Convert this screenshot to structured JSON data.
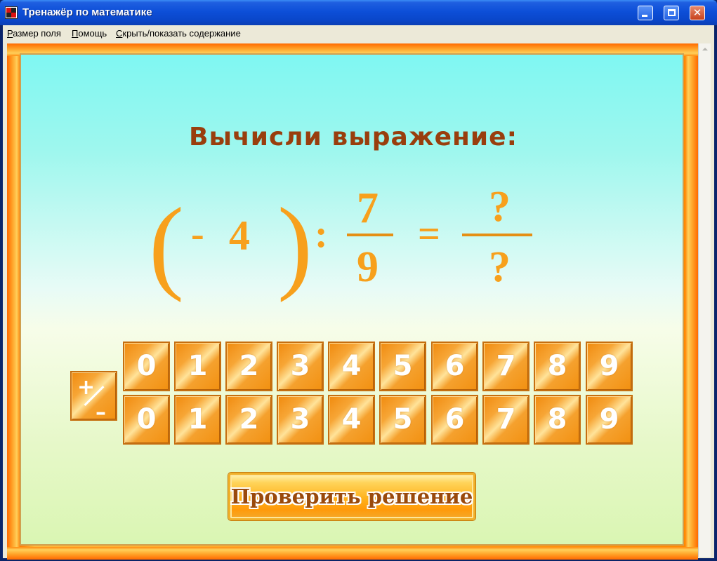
{
  "window": {
    "title": "Тренажёр по математике",
    "close_glyph": "✕"
  },
  "menu": {
    "items": [
      "Размер поля",
      "Помощь",
      "Скрыть/показать содержание"
    ]
  },
  "task": {
    "heading": "Вычисли выражение:",
    "open_paren": "(",
    "sign": "-",
    "number": "4",
    "close_paren": ")",
    "operator": ":",
    "fraction_numerator": "7",
    "fraction_denominator": "9",
    "equals": "=",
    "answer_numerator": "?",
    "answer_denominator": "?"
  },
  "keypad": {
    "sign_toggle": {
      "plus": "+",
      "minus": "–"
    },
    "numerator_digits": [
      "0",
      "1",
      "2",
      "3",
      "4",
      "5",
      "6",
      "7",
      "8",
      "9"
    ],
    "denominator_digits": [
      "0",
      "1",
      "2",
      "3",
      "4",
      "5",
      "6",
      "7",
      "8",
      "9"
    ]
  },
  "check_button": {
    "label": "Проверить решение"
  },
  "colors": {
    "title_bar": "#0a46c9",
    "heading": "#993e0d",
    "expression": "#f7a01c",
    "tile": "#f29010",
    "frame": "#ff8800"
  }
}
